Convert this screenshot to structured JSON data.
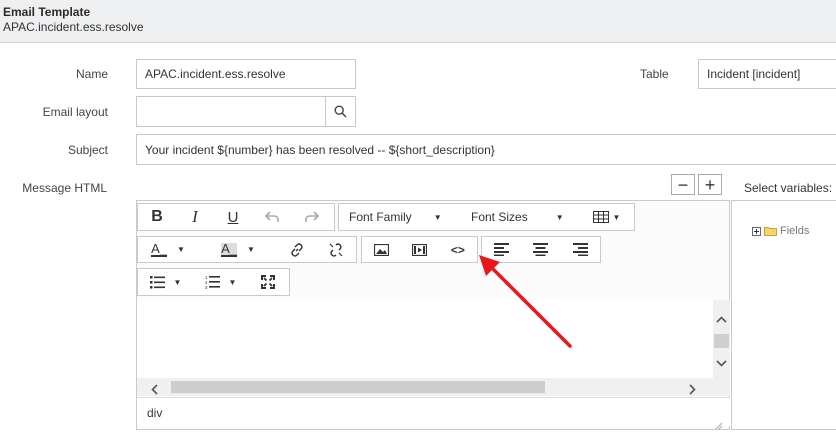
{
  "header": {
    "title": "Email Template",
    "record": "APAC.incident.ess.resolve"
  },
  "form": {
    "name_label": "Name",
    "name_value": "APAC.incident.ess.resolve",
    "table_label": "Table",
    "table_value": "Incident [incident]",
    "email_layout_label": "Email layout",
    "email_layout_value": "",
    "subject_label": "Subject",
    "subject_value": "Your incident ${number} has been resolved -- ${short_description}",
    "message_html_label": "Message HTML"
  },
  "editor": {
    "zoom_minus": "−",
    "zoom_plus": "+",
    "font_family": "Font Family",
    "font_sizes": "Font Sizes",
    "status_path": "div"
  },
  "variables": {
    "title": "Select variables:",
    "tree_fields": "Fields"
  },
  "annotation": {
    "arrow_color": "#e8181a"
  }
}
